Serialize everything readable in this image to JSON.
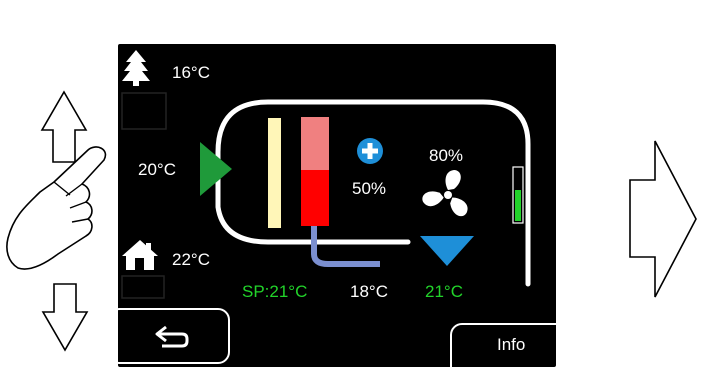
{
  "outdoor": {
    "temperature": "16°C",
    "icon": "tree-icon"
  },
  "supply": {
    "temperature": "20°C"
  },
  "indoor": {
    "temperature": "22°C",
    "icon": "house-icon"
  },
  "heater": {
    "percent": "50%",
    "icon": "plus-icon"
  },
  "fan": {
    "percent": "80%",
    "icon": "fan-icon",
    "level": 0.6
  },
  "bottom": {
    "setpoint": "SP:21°C",
    "extract_temp": "18°C",
    "target_temp": "21°C"
  },
  "buttons": {
    "back_icon": "back-arrow-icon",
    "info_label": "Info"
  },
  "colors": {
    "screen_bg": "#000000",
    "accent_green": "#1f9a3a",
    "text_green": "#22d32a",
    "heater_red": "#ff0000",
    "heater_pink": "#f08080",
    "filter_yellow": "#fff6b8",
    "pipe_blue": "#7b8fd0",
    "triangle_blue": "#1e8fd8"
  }
}
